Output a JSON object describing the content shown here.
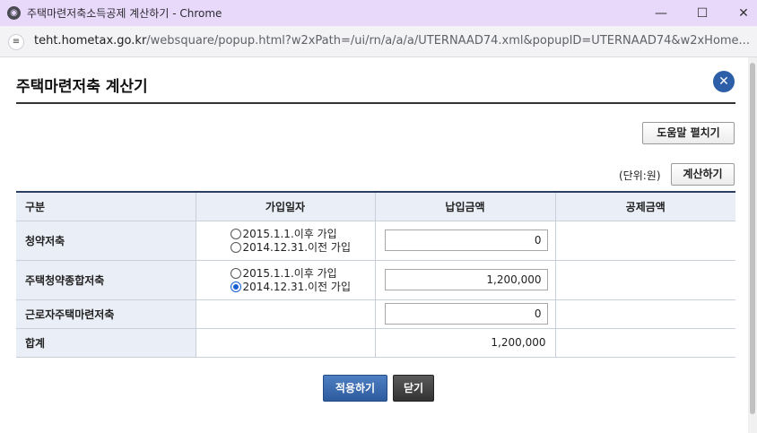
{
  "window": {
    "title": "주택마련저축소득공제 계산하기 - Chrome",
    "minimize": "—",
    "maximize": "☐",
    "close": "✕"
  },
  "address": {
    "host": "teht.hometax.go.kr",
    "path": "/websquare/popup.html?w2xPath=/ui/rn/a/a/a/UTERNAAD74.xml&popupID=UTERNAAD74&w2xHome..."
  },
  "popup": {
    "title": "주택마련저축 계산기",
    "close_icon": "✕",
    "help_button": "도움말 펼치기",
    "unit_label": "(단위:원)",
    "calc_button": "계산하기"
  },
  "table": {
    "headers": [
      "구분",
      "가입일자",
      "납입금액",
      "공제금액"
    ],
    "rows": [
      {
        "label": "청약저축",
        "options": [
          {
            "text": "2015.1.1.이후 가입",
            "selected": false
          },
          {
            "text": "2014.12.31.이전 가입",
            "selected": false
          }
        ],
        "amount": "0",
        "deduction": ""
      },
      {
        "label": "주택청약종합저축",
        "options": [
          {
            "text": "2015.1.1.이후 가입",
            "selected": false
          },
          {
            "text": "2014.12.31.이전 가입",
            "selected": true
          }
        ],
        "amount": "1,200,000",
        "deduction": ""
      },
      {
        "label": "근로자주택마련저축",
        "amount": "0",
        "deduction": ""
      },
      {
        "label": "합계",
        "total": "1,200,000",
        "deduction": ""
      }
    ]
  },
  "footer": {
    "apply_button": "적용하기",
    "close_button": "닫기"
  }
}
